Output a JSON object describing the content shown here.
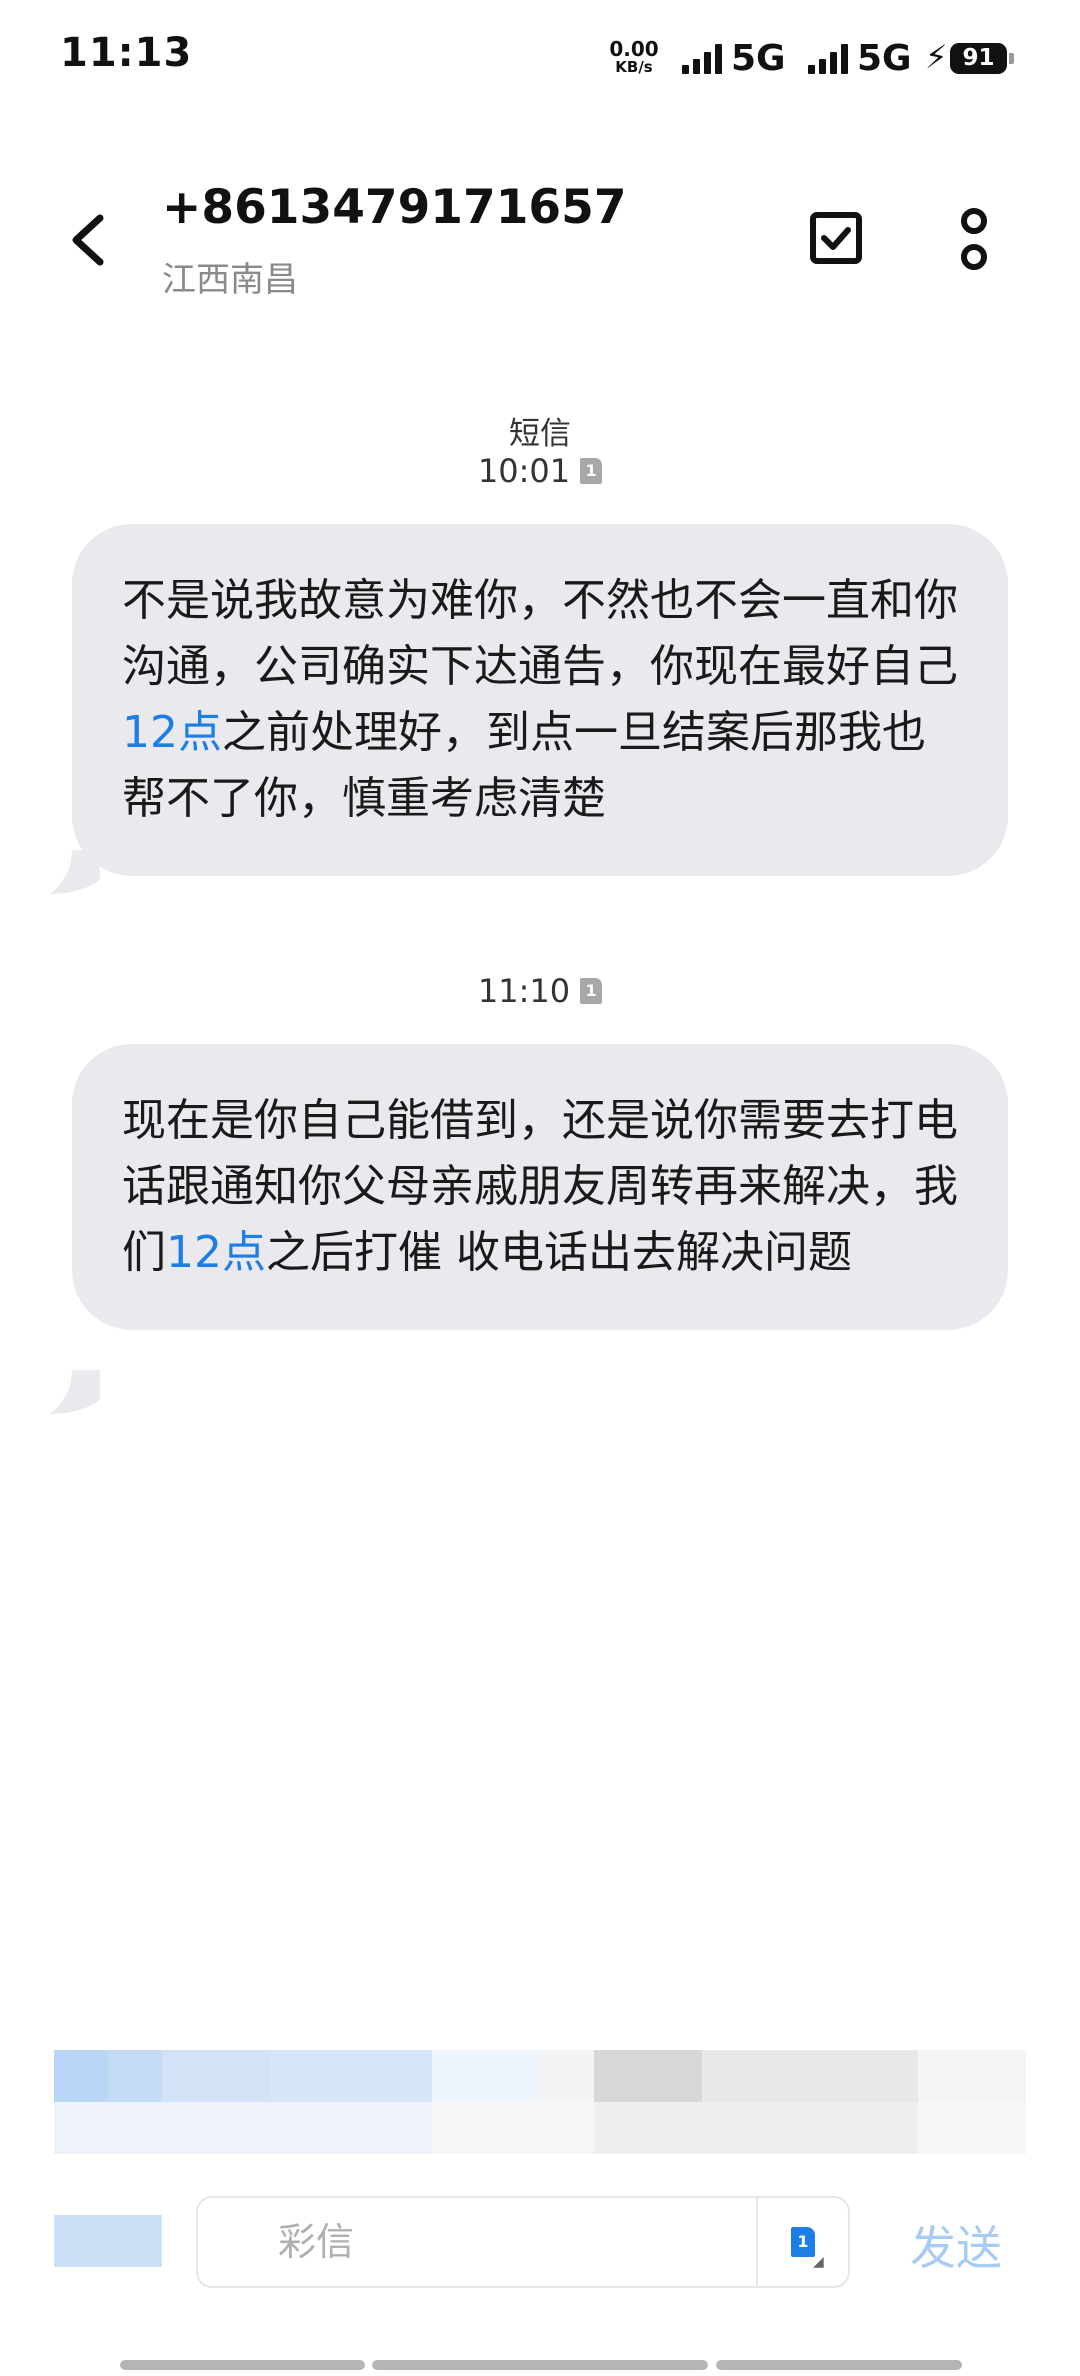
{
  "status_bar": {
    "time": "11:13",
    "net_speed_value": "0.00",
    "net_speed_unit": "KB/s",
    "sim1_network": "5G",
    "sim2_network": "5G",
    "battery_level": "91",
    "charging": true
  },
  "header": {
    "contact_number": "+8613479171657",
    "contact_location": "江西南昌",
    "icons": [
      "back-icon",
      "select-checkbox-icon",
      "more-options-icon"
    ]
  },
  "messages": [
    {
      "type_label": "短信",
      "time": "10:01",
      "sim": "1",
      "text_before": "不是说我故意为难你，不然也不会一直和你沟通，公司确实下达通告，你现在最好自己",
      "highlight": "12点",
      "text_after": "之前处理好，到点一旦结案后那我也帮不了你，慎重考虑清楚"
    },
    {
      "type_label": "",
      "time": "11:10",
      "sim": "1",
      "text_before": "现在是你自己能借到，还是说你需要去打电话跟通知你父母亲戚朋友周转再来解决，我们",
      "highlight": "12点",
      "text_after": "之后打催 收电话出去解决问题"
    }
  ],
  "composer": {
    "placeholder": "彩信",
    "sim": "1",
    "send_label": "发送"
  },
  "colors": {
    "bubble_bg": "#e9e9ee",
    "link_blue": "#1d7fe6",
    "send_disabled": "#a8cbf2"
  }
}
